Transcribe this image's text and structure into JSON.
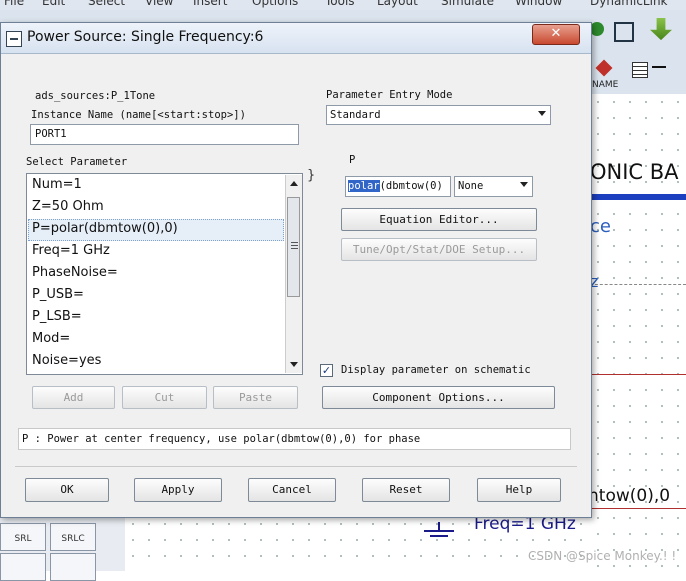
{
  "background": {
    "menu_items": [
      "File",
      "Edit",
      "Select",
      "View",
      "Insert",
      "Options",
      "Tools",
      "Layout",
      "Simulate",
      "Window",
      "DynamicLink"
    ],
    "toolbar_label": "NAME",
    "canvas_title_fragment": "ONIC BA",
    "canvas_text_ce": "ce",
    "canvas_text_z": "z",
    "canvas_freq": "Freq=1 GHz",
    "canvas_ntow": "ntow(0),0",
    "palette": [
      "SRL",
      "SRLC"
    ],
    "watermark": "CSDN @Spice Monkey.! !"
  },
  "dialog": {
    "title": "Power Source: Single Frequency:6",
    "close_label": "✕",
    "component_path": "ads_sources:P_1Tone",
    "instance_name_label": "Instance Name  (name[<start:stop>])",
    "instance_name_value": "PORT1",
    "select_parameter_label": "Select Parameter",
    "parameters": [
      "Num=1",
      "Z=50 Ohm",
      "P=polar(dbmtow(0),0)",
      "Freq=1 GHz",
      "PhaseNoise=",
      "P_USB=",
      "P_LSB=",
      "Mod=",
      "Noise=yes"
    ],
    "selected_parameter_index": 2,
    "add_label": "Add",
    "cut_label": "Cut",
    "paste_label": "Paste",
    "entry_mode_label": "Parameter Entry Mode",
    "entry_mode_value": "Standard",
    "param_name": "P",
    "param_value_selected": "polar",
    "param_value_rest": "(dbmtow(0)",
    "unit_value": "None",
    "equation_editor_label": "Equation Editor...",
    "tune_label": "Tune/Opt/Stat/DOE Setup...",
    "display_on_schematic_label": "Display parameter on schematic",
    "display_on_schematic_checked": true,
    "component_options_label": "Component Options...",
    "help_text": "P : Power at center frequency, use polar(dbmtow(0),0) for phase",
    "ok_label": "OK",
    "apply_label": "Apply",
    "cancel_label": "Cancel",
    "reset_label": "Reset",
    "help_label": "Help"
  }
}
